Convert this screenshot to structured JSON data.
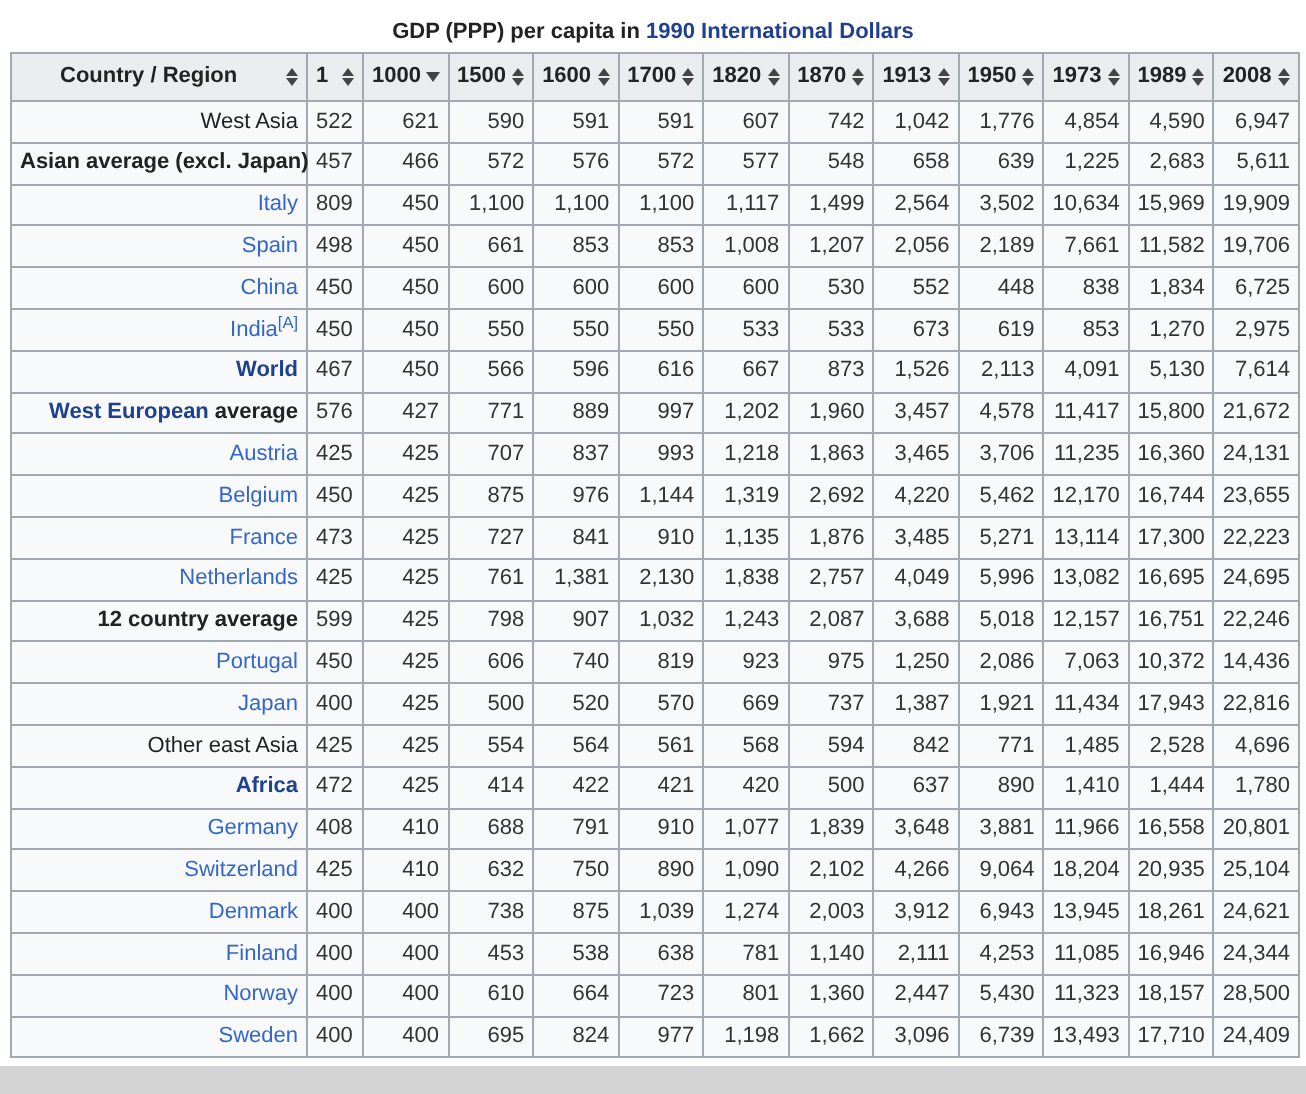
{
  "caption": {
    "text": "GDP (PPP) per capita in ",
    "link": "1990 International Dollars"
  },
  "columns": [
    {
      "label": "Country / Region",
      "sorted": false
    },
    {
      "label": "1",
      "sorted": false
    },
    {
      "label": "1000",
      "sorted": true
    },
    {
      "label": "1500",
      "sorted": false
    },
    {
      "label": "1600",
      "sorted": false
    },
    {
      "label": "1700",
      "sorted": false
    },
    {
      "label": "1820",
      "sorted": false
    },
    {
      "label": "1870",
      "sorted": false
    },
    {
      "label": "1913",
      "sorted": false
    },
    {
      "label": "1950",
      "sorted": false
    },
    {
      "label": "1973",
      "sorted": false
    },
    {
      "label": "1989",
      "sorted": false
    },
    {
      "label": "2008",
      "sorted": false
    }
  ],
  "rows": [
    {
      "name": [
        {
          "text": "West Asia",
          "kind": "plain"
        }
      ],
      "values": [
        "522",
        "621",
        "590",
        "591",
        "591",
        "607",
        "742",
        "1,042",
        "1,776",
        "4,854",
        "4,590",
        "6,947"
      ]
    },
    {
      "name": [
        {
          "text": "Asian average (excl. Japan)",
          "kind": "bold"
        }
      ],
      "values": [
        "457",
        "466",
        "572",
        "576",
        "572",
        "577",
        "548",
        "658",
        "639",
        "1,225",
        "2,683",
        "5,611"
      ]
    },
    {
      "name": [
        {
          "text": "Italy",
          "kind": "link"
        }
      ],
      "values": [
        "809",
        "450",
        "1,100",
        "1,100",
        "1,100",
        "1,117",
        "1,499",
        "2,564",
        "3,502",
        "10,634",
        "15,969",
        "19,909"
      ]
    },
    {
      "name": [
        {
          "text": "Spain",
          "kind": "link"
        }
      ],
      "values": [
        "498",
        "450",
        "661",
        "853",
        "853",
        "1,008",
        "1,207",
        "2,056",
        "2,189",
        "7,661",
        "11,582",
        "19,706"
      ]
    },
    {
      "name": [
        {
          "text": "China",
          "kind": "link"
        }
      ],
      "values": [
        "450",
        "450",
        "600",
        "600",
        "600",
        "600",
        "530",
        "552",
        "448",
        "838",
        "1,834",
        "6,725"
      ]
    },
    {
      "name": [
        {
          "text": "India$^{[A]}$",
          "kind": "link"
        }
      ],
      "values": [
        "450",
        "450",
        "550",
        "550",
        "550",
        "533",
        "533",
        "673",
        "619",
        "853",
        "1,270",
        "2,975"
      ]
    },
    {
      "name": [
        {
          "text": "World",
          "kind": "bold-link"
        }
      ],
      "values": [
        "467",
        "450",
        "566",
        "596",
        "616",
        "667",
        "873",
        "1,526",
        "2,113",
        "4,091",
        "5,130",
        "7,614"
      ]
    },
    {
      "name": [
        {
          "text": "West European",
          "kind": "bold-link"
        },
        {
          "text": "average",
          "kind": "bold"
        }
      ],
      "values": [
        "576",
        "427",
        "771",
        "889",
        "997",
        "1,202",
        "1,960",
        "3,457",
        "4,578",
        "11,417",
        "15,800",
        "21,672"
      ]
    },
    {
      "name": [
        {
          "text": "Austria",
          "kind": "link"
        }
      ],
      "values": [
        "425",
        "425",
        "707",
        "837",
        "993",
        "1,218",
        "1,863",
        "3,465",
        "3,706",
        "11,235",
        "16,360",
        "24,131"
      ]
    },
    {
      "name": [
        {
          "text": "Belgium",
          "kind": "link"
        }
      ],
      "values": [
        "450",
        "425",
        "875",
        "976",
        "1,144",
        "1,319",
        "2,692",
        "4,220",
        "5,462",
        "12,170",
        "16,744",
        "23,655"
      ]
    },
    {
      "name": [
        {
          "text": "France",
          "kind": "link"
        }
      ],
      "values": [
        "473",
        "425",
        "727",
        "841",
        "910",
        "1,135",
        "1,876",
        "3,485",
        "5,271",
        "13,114",
        "17,300",
        "22,223"
      ]
    },
    {
      "name": [
        {
          "text": "Netherlands",
          "kind": "link"
        }
      ],
      "values": [
        "425",
        "425",
        "761",
        "1,381",
        "2,130",
        "1,838",
        "2,757",
        "4,049",
        "5,996",
        "13,082",
        "16,695",
        "24,695"
      ]
    },
    {
      "name": [
        {
          "text": "12 country average",
          "kind": "bold"
        }
      ],
      "values": [
        "599",
        "425",
        "798",
        "907",
        "1,032",
        "1,243",
        "2,087",
        "3,688",
        "5,018",
        "12,157",
        "16,751",
        "22,246"
      ]
    },
    {
      "name": [
        {
          "text": "Portugal",
          "kind": "link"
        }
      ],
      "values": [
        "450",
        "425",
        "606",
        "740",
        "819",
        "923",
        "975",
        "1,250",
        "2,086",
        "7,063",
        "10,372",
        "14,436"
      ]
    },
    {
      "name": [
        {
          "text": "Japan",
          "kind": "link"
        }
      ],
      "values": [
        "400",
        "425",
        "500",
        "520",
        "570",
        "669",
        "737",
        "1,387",
        "1,921",
        "11,434",
        "17,943",
        "22,816"
      ]
    },
    {
      "name": [
        {
          "text": "Other east Asia",
          "kind": "plain"
        }
      ],
      "values": [
        "425",
        "425",
        "554",
        "564",
        "561",
        "568",
        "594",
        "842",
        "771",
        "1,485",
        "2,528",
        "4,696"
      ]
    },
    {
      "name": [
        {
          "text": "Africa",
          "kind": "bold-link"
        }
      ],
      "values": [
        "472",
        "425",
        "414",
        "422",
        "421",
        "420",
        "500",
        "637",
        "890",
        "1,410",
        "1,444",
        "1,780"
      ]
    },
    {
      "name": [
        {
          "text": "Germany",
          "kind": "link"
        }
      ],
      "values": [
        "408",
        "410",
        "688",
        "791",
        "910",
        "1,077",
        "1,839",
        "3,648",
        "3,881",
        "11,966",
        "16,558",
        "20,801"
      ]
    },
    {
      "name": [
        {
          "text": "Switzerland",
          "kind": "link"
        }
      ],
      "values": [
        "425",
        "410",
        "632",
        "750",
        "890",
        "1,090",
        "2,102",
        "4,266",
        "9,064",
        "18,204",
        "20,935",
        "25,104"
      ]
    },
    {
      "name": [
        {
          "text": "Denmark",
          "kind": "link"
        }
      ],
      "values": [
        "400",
        "400",
        "738",
        "875",
        "1,039",
        "1,274",
        "2,003",
        "3,912",
        "6,943",
        "13,945",
        "18,261",
        "24,621"
      ]
    },
    {
      "name": [
        {
          "text": "Finland",
          "kind": "link"
        }
      ],
      "values": [
        "400",
        "400",
        "453",
        "538",
        "638",
        "781",
        "1,140",
        "2,111",
        "4,253",
        "11,085",
        "16,946",
        "24,344"
      ]
    },
    {
      "name": [
        {
          "text": "Norway",
          "kind": "link"
        }
      ],
      "values": [
        "400",
        "400",
        "610",
        "664",
        "723",
        "801",
        "1,360",
        "2,447",
        "5,430",
        "11,323",
        "18,157",
        "28,500"
      ]
    },
    {
      "name": [
        {
          "text": "Sweden",
          "kind": "link"
        }
      ],
      "values": [
        "400",
        "400",
        "695",
        "824",
        "977",
        "1,198",
        "1,662",
        "3,096",
        "6,739",
        "13,493",
        "17,710",
        "24,409"
      ]
    }
  ]
}
